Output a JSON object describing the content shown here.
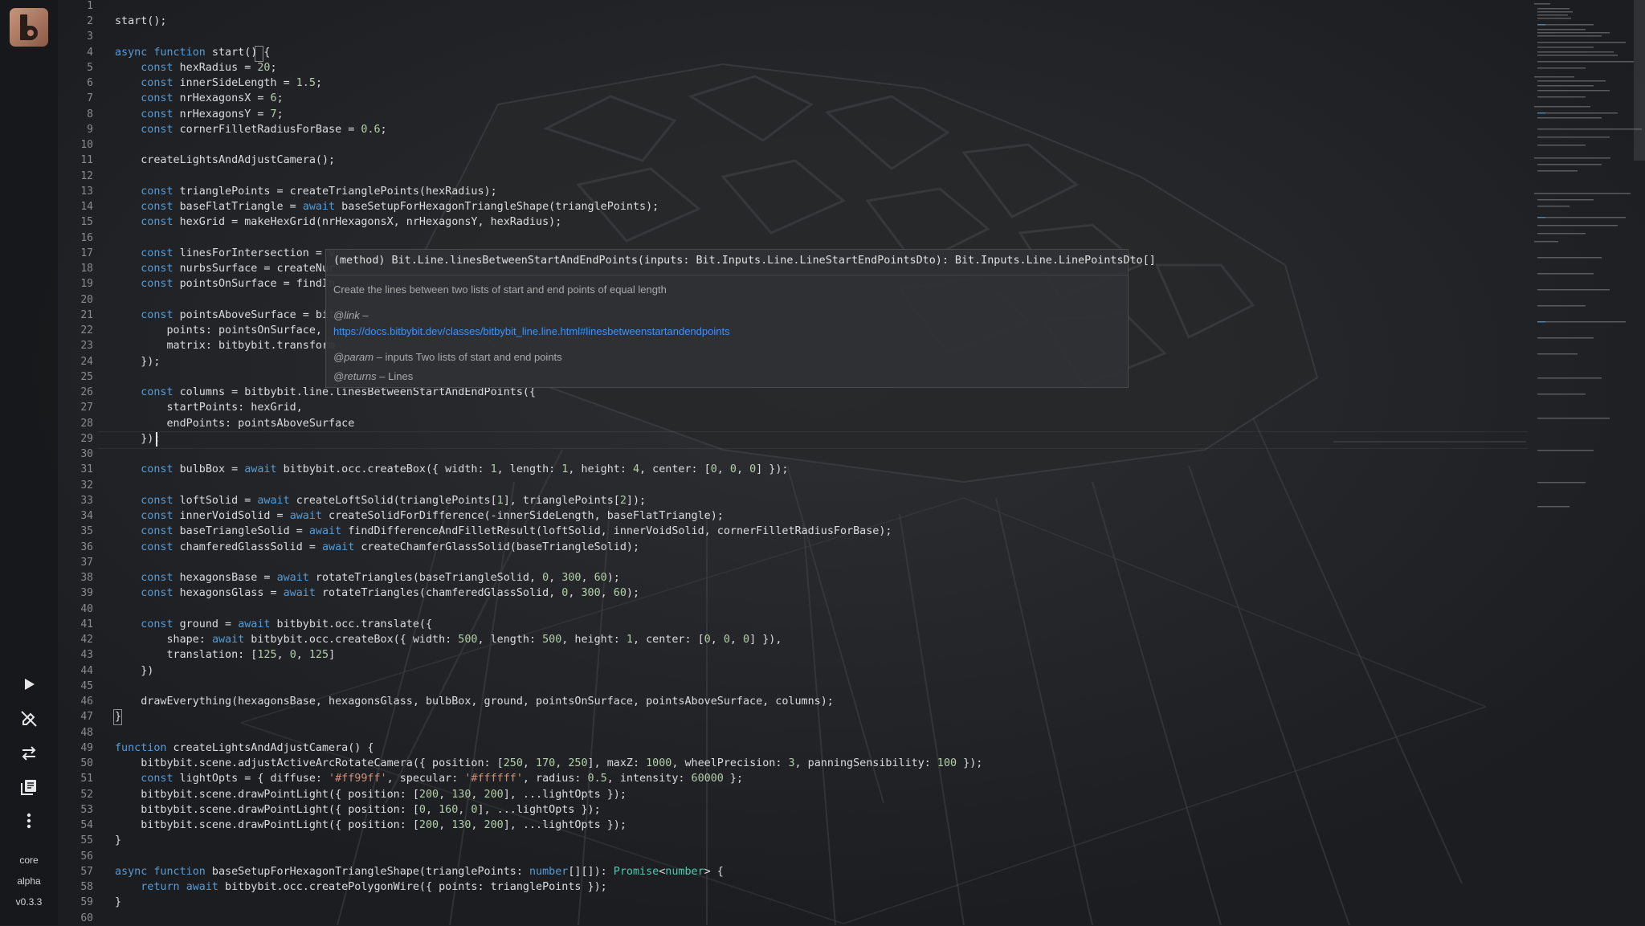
{
  "sidebar": {
    "items": [
      {
        "name": "run-button",
        "icon": "play-icon"
      },
      {
        "name": "disable-button",
        "icon": "pencil-off-icon"
      },
      {
        "name": "swap-button",
        "icon": "swap-arrows-icon"
      },
      {
        "name": "library-button",
        "icon": "book-icon"
      },
      {
        "name": "more-button",
        "icon": "kebab-menu-icon"
      }
    ],
    "labels": [
      "core",
      "alpha",
      "v0.3.3"
    ]
  },
  "hover": {
    "signature": "(method) Bit.Line.linesBetweenStartAndEndPoints(inputs: Bit.Inputs.Line.LineStartEndPointsDto): Bit.Inputs.Line.LinePointsDto[]",
    "description": "Create the lines between two lists of start and end points of equal length",
    "link_tag": "@link",
    "link_dash": " –",
    "link_url": "https://docs.bitbybit.dev/classes/bitbybit_line.line.html#linesbetweenstartandendpoints",
    "param_tag": "@param",
    "param_text": " – inputs Two lists of start and end points",
    "returns_tag": "@returns",
    "returns_text": " – Lines"
  },
  "editor": {
    "accent": "#569cd6",
    "lines": [
      [],
      [
        [
          "start();",
          "p"
        ]
      ],
      [],
      [
        [
          "async",
          "kw"
        ],
        [
          " ",
          "p"
        ],
        [
          "function",
          "kw"
        ],
        [
          " start() {",
          "p"
        ]
      ],
      [
        [
          "    ",
          "p"
        ],
        [
          "const",
          "kw"
        ],
        [
          " hexRadius = ",
          "p"
        ],
        [
          "20",
          "num"
        ],
        [
          ";",
          "p"
        ]
      ],
      [
        [
          "    ",
          "p"
        ],
        [
          "const",
          "kw"
        ],
        [
          " innerSideLength = ",
          "p"
        ],
        [
          "1.5",
          "num"
        ],
        [
          ";",
          "p"
        ]
      ],
      [
        [
          "    ",
          "p"
        ],
        [
          "const",
          "kw"
        ],
        [
          " nrHexagonsX = ",
          "p"
        ],
        [
          "6",
          "num"
        ],
        [
          ";",
          "p"
        ]
      ],
      [
        [
          "    ",
          "p"
        ],
        [
          "const",
          "kw"
        ],
        [
          " nrHexagonsY = ",
          "p"
        ],
        [
          "7",
          "num"
        ],
        [
          ";",
          "p"
        ]
      ],
      [
        [
          "    ",
          "p"
        ],
        [
          "const",
          "kw"
        ],
        [
          " cornerFilletRadiusForBase = ",
          "p"
        ],
        [
          "0.6",
          "num"
        ],
        [
          ";",
          "p"
        ]
      ],
      [],
      [
        [
          "    createLightsAndAdjustCamera();",
          "p"
        ]
      ],
      [],
      [
        [
          "    ",
          "p"
        ],
        [
          "const",
          "kw"
        ],
        [
          " trianglePoints = createTrianglePoints(hexRadius);",
          "p"
        ]
      ],
      [
        [
          "    ",
          "p"
        ],
        [
          "const",
          "kw"
        ],
        [
          " baseFlatTriangle = ",
          "p"
        ],
        [
          "await",
          "aw"
        ],
        [
          " baseSetupForHexagonTriangleShape(trianglePoints);",
          "p"
        ]
      ],
      [
        [
          "    ",
          "p"
        ],
        [
          "const",
          "kw"
        ],
        [
          " hexGrid = makeHexGrid(nrHexagonsX, nrHexagonsY, hexRadius);",
          "p"
        ]
      ],
      [],
      [
        [
          "    ",
          "p"
        ],
        [
          "const",
          "kw"
        ],
        [
          " linesForIntersection = v",
          "p"
        ]
      ],
      [
        [
          "    ",
          "p"
        ],
        [
          "const",
          "kw"
        ],
        [
          " nurbsSurface = createNur",
          "p"
        ]
      ],
      [
        [
          "    ",
          "p"
        ],
        [
          "const",
          "kw"
        ],
        [
          " pointsOnSurface = findIn",
          "p"
        ]
      ],
      [],
      [
        [
          "    ",
          "p"
        ],
        [
          "const",
          "kw"
        ],
        [
          " pointsAboveSurface = bit",
          "p"
        ]
      ],
      [
        [
          "        points: pointsOnSurface,",
          "p"
        ]
      ],
      [
        [
          "        matrix: bitbybit.transform",
          "p"
        ]
      ],
      [
        [
          "    });",
          "p"
        ]
      ],
      [],
      [
        [
          "    ",
          "p"
        ],
        [
          "const",
          "kw"
        ],
        [
          " columns = bitbybit.line.linesBetweenStartAndEndPoints({",
          "p"
        ]
      ],
      [
        [
          "        startPoints: hexGrid,",
          "p"
        ]
      ],
      [
        [
          "        endPoints: pointsAboveSurface",
          "p"
        ]
      ],
      [
        [
          "    });",
          "p"
        ]
      ],
      [],
      [
        [
          "    ",
          "p"
        ],
        [
          "const",
          "kw"
        ],
        [
          " bulbBox = ",
          "p"
        ],
        [
          "await",
          "aw"
        ],
        [
          " bitbybit.occ.createBox({ width: ",
          "p"
        ],
        [
          "1",
          "num"
        ],
        [
          ", length: ",
          "p"
        ],
        [
          "1",
          "num"
        ],
        [
          ", height: ",
          "p"
        ],
        [
          "4",
          "num"
        ],
        [
          ", center: [",
          "p"
        ],
        [
          "0",
          "num"
        ],
        [
          ", ",
          "p"
        ],
        [
          "0",
          "num"
        ],
        [
          ", ",
          "p"
        ],
        [
          "0",
          "num"
        ],
        [
          "] });",
          "p"
        ]
      ],
      [],
      [
        [
          "    ",
          "p"
        ],
        [
          "const",
          "kw"
        ],
        [
          " loftSolid = ",
          "p"
        ],
        [
          "await",
          "aw"
        ],
        [
          " createLoftSolid(trianglePoints[",
          "p"
        ],
        [
          "1",
          "num"
        ],
        [
          "], trianglePoints[",
          "p"
        ],
        [
          "2",
          "num"
        ],
        [
          "]);",
          "p"
        ]
      ],
      [
        [
          "    ",
          "p"
        ],
        [
          "const",
          "kw"
        ],
        [
          " innerVoidSolid = ",
          "p"
        ],
        [
          "await",
          "aw"
        ],
        [
          " createSolidForDifference(-innerSideLength, baseFlatTriangle);",
          "p"
        ]
      ],
      [
        [
          "    ",
          "p"
        ],
        [
          "const",
          "kw"
        ],
        [
          " baseTriangleSolid = ",
          "p"
        ],
        [
          "await",
          "aw"
        ],
        [
          " findDifferenceAndFilletResult(loftSolid, innerVoidSolid, cornerFilletRadiusForBase);",
          "p"
        ]
      ],
      [
        [
          "    ",
          "p"
        ],
        [
          "const",
          "kw"
        ],
        [
          " chamferedGlassSolid = ",
          "p"
        ],
        [
          "await",
          "aw"
        ],
        [
          " createChamferGlassSolid(baseTriangleSolid);",
          "p"
        ]
      ],
      [],
      [
        [
          "    ",
          "p"
        ],
        [
          "const",
          "kw"
        ],
        [
          " hexagonsBase = ",
          "p"
        ],
        [
          "await",
          "aw"
        ],
        [
          " rotateTriangles(baseTriangleSolid, ",
          "p"
        ],
        [
          "0",
          "num"
        ],
        [
          ", ",
          "p"
        ],
        [
          "300",
          "num"
        ],
        [
          ", ",
          "p"
        ],
        [
          "60",
          "num"
        ],
        [
          ");",
          "p"
        ]
      ],
      [
        [
          "    ",
          "p"
        ],
        [
          "const",
          "kw"
        ],
        [
          " hexagonsGlass = ",
          "p"
        ],
        [
          "await",
          "aw"
        ],
        [
          " rotateTriangles(chamferedGlassSolid, ",
          "p"
        ],
        [
          "0",
          "num"
        ],
        [
          ", ",
          "p"
        ],
        [
          "300",
          "num"
        ],
        [
          ", ",
          "p"
        ],
        [
          "60",
          "num"
        ],
        [
          ");",
          "p"
        ]
      ],
      [],
      [
        [
          "    ",
          "p"
        ],
        [
          "const",
          "kw"
        ],
        [
          " ground = ",
          "p"
        ],
        [
          "await",
          "aw"
        ],
        [
          " bitbybit.occ.translate({",
          "p"
        ]
      ],
      [
        [
          "        shape: ",
          "p"
        ],
        [
          "await",
          "aw"
        ],
        [
          " bitbybit.occ.createBox({ width: ",
          "p"
        ],
        [
          "500",
          "num"
        ],
        [
          ", length: ",
          "p"
        ],
        [
          "500",
          "num"
        ],
        [
          ", height: ",
          "p"
        ],
        [
          "1",
          "num"
        ],
        [
          ", center: [",
          "p"
        ],
        [
          "0",
          "num"
        ],
        [
          ", ",
          "p"
        ],
        [
          "0",
          "num"
        ],
        [
          ", ",
          "p"
        ],
        [
          "0",
          "num"
        ],
        [
          "] }),",
          "p"
        ]
      ],
      [
        [
          "        translation: [",
          "p"
        ],
        [
          "125",
          "num"
        ],
        [
          ", ",
          "p"
        ],
        [
          "0",
          "num"
        ],
        [
          ", ",
          "p"
        ],
        [
          "125",
          "num"
        ],
        [
          "]",
          "p"
        ]
      ],
      [
        [
          "    })",
          "p"
        ]
      ],
      [],
      [
        [
          "    drawEverything(hexagonsBase, hexagonsGlass, bulbBox, ground, pointsOnSurface, pointsAboveSurface, columns);",
          "p"
        ]
      ],
      [
        [
          "}",
          "p"
        ]
      ],
      [],
      [
        [
          "function",
          "kw"
        ],
        [
          " createLightsAndAdjustCamera() {",
          "p"
        ]
      ],
      [
        [
          "    bitbybit.scene.adjustActiveArcRotateCamera({ position: [",
          "p"
        ],
        [
          "250",
          "num"
        ],
        [
          ", ",
          "p"
        ],
        [
          "170",
          "num"
        ],
        [
          ", ",
          "p"
        ],
        [
          "250",
          "num"
        ],
        [
          "], maxZ: ",
          "p"
        ],
        [
          "1000",
          "num"
        ],
        [
          ", wheelPrecision: ",
          "p"
        ],
        [
          "3",
          "num"
        ],
        [
          ", panningSensibility: ",
          "p"
        ],
        [
          "100",
          "num"
        ],
        [
          " });",
          "p"
        ]
      ],
      [
        [
          "    ",
          "p"
        ],
        [
          "const",
          "kw"
        ],
        [
          " lightOpts = { diffuse: ",
          "p"
        ],
        [
          "'#ff99ff'",
          "str"
        ],
        [
          ", specular: ",
          "p"
        ],
        [
          "'#ffffff'",
          "str"
        ],
        [
          ", radius: ",
          "p"
        ],
        [
          "0.5",
          "num"
        ],
        [
          ", intensity: ",
          "p"
        ],
        [
          "60000",
          "num"
        ],
        [
          " };",
          "p"
        ]
      ],
      [
        [
          "    bitbybit.scene.drawPointLight({ position: [",
          "p"
        ],
        [
          "200",
          "num"
        ],
        [
          ", ",
          "p"
        ],
        [
          "130",
          "num"
        ],
        [
          ", ",
          "p"
        ],
        [
          "200",
          "num"
        ],
        [
          "], ...lightOpts });",
          "p"
        ]
      ],
      [
        [
          "    bitbybit.scene.drawPointLight({ position: [",
          "p"
        ],
        [
          "0",
          "num"
        ],
        [
          ", ",
          "p"
        ],
        [
          "160",
          "num"
        ],
        [
          ", ",
          "p"
        ],
        [
          "0",
          "num"
        ],
        [
          "], ...lightOpts });",
          "p"
        ]
      ],
      [
        [
          "    bitbybit.scene.drawPointLight({ position: [",
          "p"
        ],
        [
          "200",
          "num"
        ],
        [
          ", ",
          "p"
        ],
        [
          "130",
          "num"
        ],
        [
          ", ",
          "p"
        ],
        [
          "200",
          "num"
        ],
        [
          "], ...lightOpts });",
          "p"
        ]
      ],
      [
        [
          "}",
          "p"
        ]
      ],
      [],
      [
        [
          "async",
          "kw"
        ],
        [
          " ",
          "p"
        ],
        [
          "function",
          "kw"
        ],
        [
          " baseSetupForHexagonTriangleShape(trianglePoints: ",
          "p"
        ],
        [
          "number",
          "kw"
        ],
        [
          "[][]): ",
          "p"
        ],
        [
          "Promise",
          "ty"
        ],
        [
          "<",
          "p"
        ],
        [
          "number",
          "ty"
        ],
        [
          "> {",
          "p"
        ]
      ],
      [
        [
          "    ",
          "p"
        ],
        [
          "return",
          "kw"
        ],
        [
          " ",
          "p"
        ],
        [
          "await",
          "aw"
        ],
        [
          " bitbybit.occ.createPolygonWire({ points: trianglePoints });",
          "p"
        ]
      ],
      [
        [
          "}",
          "p"
        ]
      ],
      []
    ]
  }
}
